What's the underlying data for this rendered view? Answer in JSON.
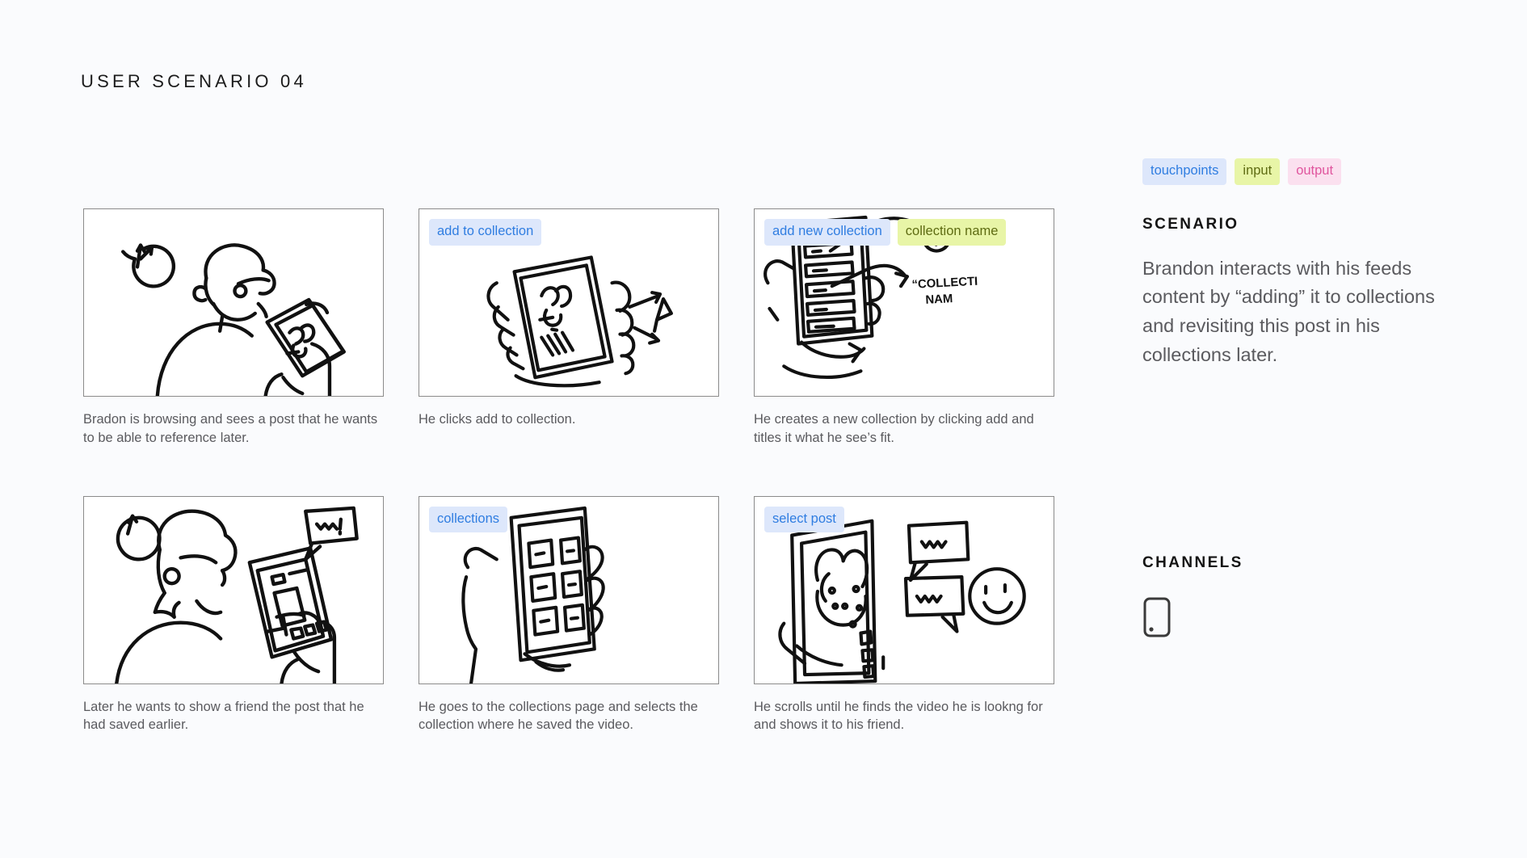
{
  "header": {
    "title": "USER SCENARIO 04"
  },
  "legend": [
    {
      "label": "touchpoints",
      "kind": "touchpoints",
      "color": "#dde7fb"
    },
    {
      "label": "input",
      "kind": "input",
      "color": "#e8f5a7"
    },
    {
      "label": "output",
      "kind": "output",
      "color": "#fbe0ef"
    }
  ],
  "rail": {
    "scenario_heading": "SCENARIO",
    "scenario_body": "Brandon interacts with his feeds content by “adding” it to collections and revisiting this post in his collections later.",
    "channels_heading": "CHANNELS",
    "channel_icon": "mobile-phone-icon"
  },
  "panels": [
    {
      "id": "panel-1",
      "tags": [],
      "caption": "Bradon is browsing and sees a post that he wants to be able to reference later.",
      "sketch": "person-with-phone-and-clock"
    },
    {
      "id": "panel-2",
      "tags": [
        {
          "label": "add to collection",
          "kind": "touchpoints"
        }
      ],
      "caption": "He clicks add to collection.",
      "sketch": "hand-holding-phone-post-bookmark"
    },
    {
      "id": "panel-3",
      "tags": [
        {
          "label": "add new collection",
          "kind": "touchpoints"
        },
        {
          "label": "collection name",
          "kind": "input"
        }
      ],
      "caption": "He creates a new collection by clicking add and titles it what he see’s fit.",
      "sketch": "phone-list-with-plus-and-collection-name",
      "sketch_text": {
        "plus": "+",
        "handwriting_line1": "“COLLECTI",
        "handwriting_line2": "NAM"
      }
    },
    {
      "id": "panel-4",
      "tags": [],
      "caption": "Later he wants to show a friend the post that he had saved earlier.",
      "sketch": "person-reading-phone-with-speech-bubble"
    },
    {
      "id": "panel-5",
      "tags": [
        {
          "label": "collections",
          "kind": "touchpoints"
        }
      ],
      "caption": "He goes to the collections page and selects the collection where he saved the video.",
      "sketch": "hand-holding-phone-collections-grid"
    },
    {
      "id": "panel-6",
      "tags": [
        {
          "label": "select post",
          "kind": "touchpoints"
        }
      ],
      "caption": "He scrolls until he finds the video he is lookng for and shows it to his friend.",
      "sketch": "phone-post-with-speech-bubbles-and-smiley"
    }
  ]
}
